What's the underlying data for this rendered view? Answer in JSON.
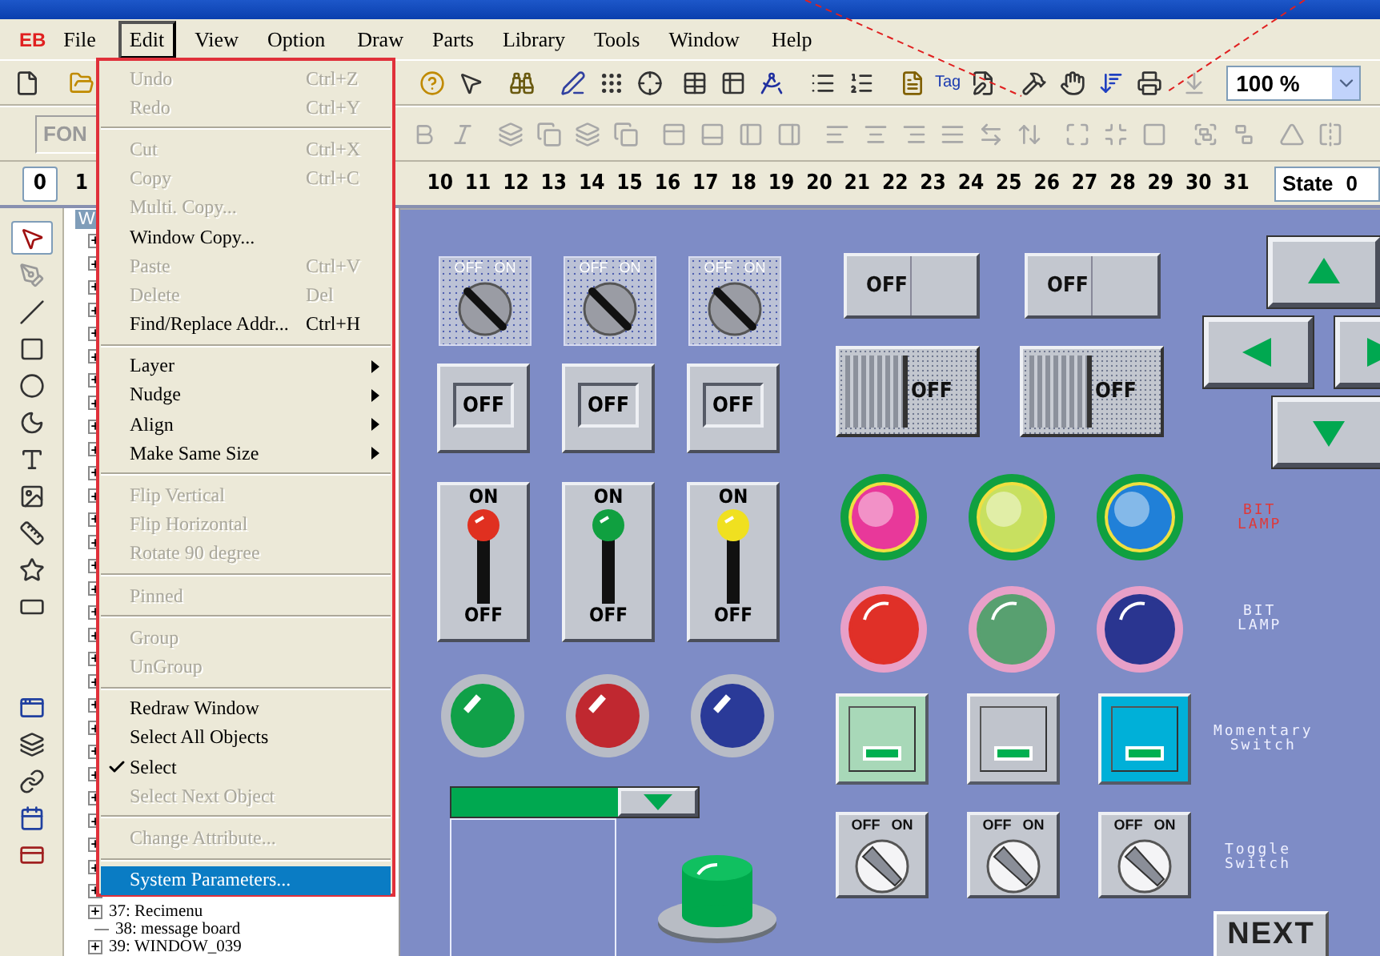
{
  "menu_bar": {
    "logo": "EB",
    "items": [
      {
        "label": "File",
        "selected": false
      },
      {
        "label": "Edit",
        "selected": true
      },
      {
        "label": "View",
        "selected": false
      },
      {
        "label": "Option",
        "selected": false
      },
      {
        "label": "Draw",
        "selected": false
      },
      {
        "label": "Parts",
        "selected": false
      },
      {
        "label": "Library",
        "selected": false
      },
      {
        "label": "Tools",
        "selected": false
      },
      {
        "label": "Window",
        "selected": false
      },
      {
        "label": "Help",
        "selected": false
      }
    ]
  },
  "toolbar": {
    "tag_button": "Tag",
    "zoom": "100 %"
  },
  "format_bar": {
    "font_field": "FON"
  },
  "window_numbers": [
    {
      "label": "0",
      "selected": true
    },
    {
      "label": "1",
      "selected": false
    },
    {
      "label": "10",
      "selected": false
    },
    {
      "label": "11",
      "selected": false
    },
    {
      "label": "12",
      "selected": false
    },
    {
      "label": "13",
      "selected": false
    },
    {
      "label": "14",
      "selected": false
    },
    {
      "label": "15",
      "selected": false
    },
    {
      "label": "16",
      "selected": false
    },
    {
      "label": "17",
      "selected": false
    },
    {
      "label": "18",
      "selected": false
    },
    {
      "label": "19",
      "selected": false
    },
    {
      "label": "20",
      "selected": false
    },
    {
      "label": "21",
      "selected": false
    },
    {
      "label": "22",
      "selected": false
    },
    {
      "label": "23",
      "selected": false
    },
    {
      "label": "24",
      "selected": false
    },
    {
      "label": "25",
      "selected": false
    },
    {
      "label": "26",
      "selected": false
    },
    {
      "label": "27",
      "selected": false
    },
    {
      "label": "28",
      "selected": false
    },
    {
      "label": "29",
      "selected": false
    },
    {
      "label": "30",
      "selected": false
    },
    {
      "label": "31",
      "selected": false
    }
  ],
  "state_field": {
    "label": "State",
    "value": "0"
  },
  "tools": [
    {
      "kind": "pointer",
      "selected": true
    },
    {
      "kind": "node",
      "selected": false
    },
    {
      "kind": "line",
      "selected": false
    },
    {
      "kind": "rect",
      "selected": false
    },
    {
      "kind": "circle",
      "selected": false
    },
    {
      "kind": "arc",
      "selected": false
    },
    {
      "kind": "text",
      "selected": false
    },
    {
      "kind": "bitmap",
      "selected": false
    },
    {
      "kind": "scale",
      "selected": false
    },
    {
      "kind": "polygon",
      "selected": false
    },
    {
      "kind": "frame",
      "selected": false
    },
    {
      "kind": "window",
      "selected": false
    },
    {
      "kind": "stack",
      "selected": false
    },
    {
      "kind": "link",
      "selected": false
    },
    {
      "kind": "form",
      "selected": false
    },
    {
      "kind": "card",
      "selected": false
    }
  ],
  "tree": {
    "tab": "W",
    "rows": [
      {
        "expandable": true
      },
      {
        "expandable": true
      },
      {
        "expandable": true
      },
      {
        "expandable": true
      },
      {
        "expandable": true
      },
      {
        "expandable": true
      },
      {
        "expandable": true
      },
      {
        "expandable": true
      },
      {
        "expandable": true
      },
      {
        "expandable": true
      },
      {
        "expandable": true
      },
      {
        "expandable": true
      },
      {
        "expandable": true
      },
      {
        "expandable": true
      },
      {
        "expandable": true
      },
      {
        "expandable": true
      },
      {
        "expandable": true
      },
      {
        "expandable": true
      },
      {
        "expandable": true
      },
      {
        "expandable": true
      },
      {
        "expandable": true
      },
      {
        "expandable": true
      },
      {
        "expandable": true
      },
      {
        "expandable": true
      },
      {
        "expandable": true
      },
      {
        "expandable": true
      },
      {
        "expandable": true
      },
      {
        "expandable": true
      },
      {
        "expandable": true
      },
      {
        "label": "37: Recimenu",
        "expandable": true
      },
      {
        "label": "38: message board",
        "expandable": false
      },
      {
        "label": "39: WINDOW_039",
        "expandable": true
      }
    ]
  },
  "edit_menu": [
    {
      "kind": "item",
      "label": "Undo",
      "shortcut": "Ctrl+Z",
      "disabled": true,
      "checked": false,
      "selected": false
    },
    {
      "kind": "item",
      "label": "Redo",
      "shortcut": "Ctrl+Y",
      "disabled": true,
      "checked": false,
      "selected": false
    },
    {
      "kind": "separator"
    },
    {
      "kind": "item",
      "label": "Cut",
      "shortcut": "Ctrl+X",
      "disabled": true,
      "checked": false,
      "selected": false
    },
    {
      "kind": "item",
      "label": "Copy",
      "shortcut": "Ctrl+C",
      "disabled": true,
      "checked": false,
      "selected": false
    },
    {
      "kind": "item",
      "label": "Multi. Copy...",
      "disabled": true,
      "checked": false,
      "selected": false
    },
    {
      "kind": "item",
      "label": "Window Copy...",
      "disabled": false,
      "checked": false,
      "selected": false
    },
    {
      "kind": "item",
      "label": "Paste",
      "shortcut": "Ctrl+V",
      "disabled": true,
      "checked": false,
      "selected": false
    },
    {
      "kind": "item",
      "label": "Delete",
      "shortcut": "Del",
      "disabled": true,
      "checked": false,
      "selected": false
    },
    {
      "kind": "item",
      "label": "Find/Replace Addr...",
      "shortcut": "Ctrl+H",
      "disabled": false,
      "checked": false,
      "selected": false
    },
    {
      "kind": "separator"
    },
    {
      "kind": "submenu",
      "label": "Layer",
      "disabled": false,
      "checked": false,
      "selected": false
    },
    {
      "kind": "submenu",
      "label": "Nudge",
      "disabled": false,
      "checked": false,
      "selected": false
    },
    {
      "kind": "submenu",
      "label": "Align",
      "disabled": false,
      "checked": false,
      "selected": false
    },
    {
      "kind": "submenu",
      "label": "Make Same Size",
      "disabled": false,
      "checked": false,
      "selected": false
    },
    {
      "kind": "separator"
    },
    {
      "kind": "item",
      "label": "Flip Vertical",
      "disabled": true,
      "checked": false,
      "selected": false
    },
    {
      "kind": "item",
      "label": "Flip Horizontal",
      "disabled": true,
      "checked": false,
      "selected": false
    },
    {
      "kind": "item",
      "label": "Rotate 90 degree",
      "disabled": true,
      "checked": false,
      "selected": false
    },
    {
      "kind": "separator"
    },
    {
      "kind": "item",
      "label": "Pinned",
      "disabled": true,
      "checked": false,
      "selected": false
    },
    {
      "kind": "separator"
    },
    {
      "kind": "item",
      "label": "Group",
      "disabled": true,
      "checked": false,
      "selected": false
    },
    {
      "kind": "item",
      "label": "UnGroup",
      "disabled": true,
      "checked": false,
      "selected": false
    },
    {
      "kind": "separator"
    },
    {
      "kind": "item",
      "label": "Redraw Window",
      "disabled": false,
      "checked": false,
      "selected": false
    },
    {
      "kind": "item",
      "label": "Select All Objects",
      "disabled": false,
      "checked": false,
      "selected": false
    },
    {
      "kind": "item",
      "label": "Select",
      "disabled": false,
      "checked": true,
      "selected": false
    },
    {
      "kind": "item",
      "label": "Select Next Object",
      "disabled": true,
      "checked": false,
      "selected": false
    },
    {
      "kind": "separator"
    },
    {
      "kind": "item",
      "label": "Change Attribute...",
      "disabled": true,
      "checked": false,
      "selected": false
    },
    {
      "kind": "separator"
    },
    {
      "kind": "item",
      "label": "System Parameters...",
      "disabled": false,
      "checked": false,
      "selected": true
    }
  ],
  "canvas": {
    "rotary_selectors": [
      {
        "off": "OFF",
        "on": "ON",
        "checked": false
      },
      {
        "off": "OFF",
        "on": "ON",
        "checked": false
      },
      {
        "off": "OFF",
        "on": "ON",
        "checked": false
      }
    ],
    "off_buttons": [
      {
        "label": "OFF"
      },
      {
        "label": "OFF"
      },
      {
        "label": "OFF"
      }
    ],
    "lever_switches": [
      {
        "on": "ON",
        "off": "OFF",
        "color": "#e03020"
      },
      {
        "on": "ON",
        "off": "OFF",
        "color": "#10a040"
      },
      {
        "on": "ON",
        "off": "OFF",
        "color": "#f0e020"
      }
    ],
    "pilot_lamps": [
      {
        "color": "#10a048"
      },
      {
        "color": "#c02830"
      },
      {
        "color": "#2a3a98"
      }
    ],
    "slide_buttons": [
      {
        "label": "OFF"
      },
      {
        "label": "OFF"
      }
    ],
    "slide_switches": [
      {
        "label": "OFF",
        "checked": false
      },
      {
        "label": "OFF",
        "checked": false
      }
    ],
    "arrow_buttons": [
      {
        "kind": "up"
      },
      {
        "kind": "left"
      },
      {
        "kind": "right"
      },
      {
        "kind": "down"
      }
    ],
    "bit_lamp_rows": [
      {
        "label": "BIT LAMP",
        "color": "#e03838",
        "lamps": [
          {
            "color": "#e8389a"
          },
          {
            "color": "#c8e060"
          },
          {
            "color": "#2080d8"
          }
        ]
      },
      {
        "label": "BIT LAMP",
        "color": "#eef0ff",
        "lamps": [
          {
            "color": "#e03028"
          },
          {
            "color": "#58a070"
          },
          {
            "color": "#2a3590"
          }
        ]
      }
    ],
    "momentary_switches": {
      "label": "Momentary Switch",
      "items": [
        {
          "color": "#a8d8b8"
        },
        {
          "color": "#c0c4cc"
        },
        {
          "color": "#00b0d8"
        }
      ]
    },
    "toggle_switches": {
      "label": "Toggle Switch",
      "items": [
        {
          "off": "OFF",
          "on": "ON",
          "checked": false
        },
        {
          "off": "OFF",
          "on": "ON",
          "checked": false
        },
        {
          "off": "OFF",
          "on": "ON",
          "checked": false
        }
      ]
    },
    "next_button": "NEXT"
  }
}
